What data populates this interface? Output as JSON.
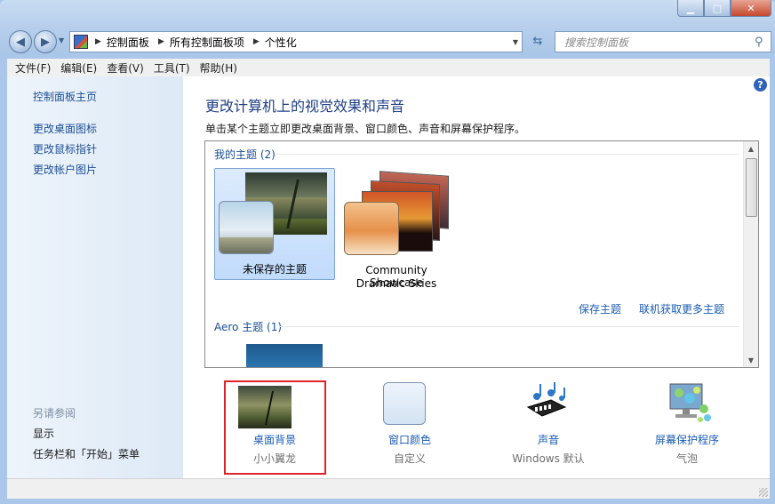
{
  "window": {
    "caption_buttons": [
      "minimize-icon",
      "maximize-icon",
      "close-icon"
    ]
  },
  "nav": {
    "back_icon": "back-arrow-icon",
    "forward_icon": "forward-arrow-icon",
    "breadcrumbs": [
      "控制面板",
      "所有控制面板项",
      "个性化"
    ],
    "search_placeholder": "搜索控制面板"
  },
  "menu": {
    "items": [
      "文件(F)",
      "编辑(E)",
      "查看(V)",
      "工具(T)",
      "帮助(H)"
    ]
  },
  "sidebar": {
    "home_link": "控制面板主页",
    "links": [
      "更改桌面图标",
      "更改鼠标指针",
      "更改帐户图片"
    ],
    "see_also_label": "另请参阅",
    "see_also": [
      "显示",
      "任务栏和「开始」菜单"
    ]
  },
  "main": {
    "title": "更改计算机上的视觉效果和声音",
    "description": "单击某个主题立即更改桌面背景、窗口颜色、声音和屏幕保护程序。",
    "my_themes_header": "我的主题 (2)",
    "themes": [
      {
        "label": "未保存的主题",
        "selected": true
      },
      {
        "label_line1": "Community Showcase",
        "label_line2": "Dramatic Skies",
        "selected": false
      }
    ],
    "save_theme_link": "保存主题",
    "get_more_link": "联机获取更多主题",
    "aero_header": "Aero 主题 (1)"
  },
  "bottom": {
    "items": [
      {
        "name": "桌面背景",
        "sub": "小小翼龙",
        "icon": "desktop-background-icon",
        "highlighted": true
      },
      {
        "name": "窗口颜色",
        "sub": "自定义",
        "icon": "window-color-icon"
      },
      {
        "name": "声音",
        "sub": "Windows 默认",
        "icon": "sound-icon"
      },
      {
        "name": "屏幕保护程序",
        "sub": "气泡",
        "icon": "screen-saver-icon"
      }
    ],
    "highlight_color": "#e0232a"
  },
  "colors": {
    "link": "#1b5cb3",
    "title": "#1f3e84"
  }
}
